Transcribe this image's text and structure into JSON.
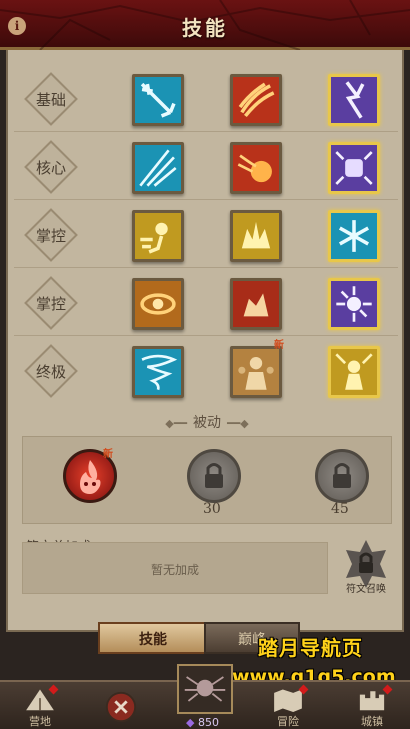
{
  "header": {
    "title": "技能",
    "info_icon": "i"
  },
  "rows": [
    {
      "label": "基础",
      "skills": [
        "trident-icon",
        "claw-fire-icon",
        "lightning-icon"
      ]
    },
    {
      "label": "核心",
      "skills": [
        "ice-shards-icon",
        "fireball-icon",
        "fist-shock-icon"
      ]
    },
    {
      "label": "掌控",
      "skills": [
        "dash-icon",
        "crown-burst-icon",
        "snowflake-icon"
      ]
    },
    {
      "label": "掌控",
      "skills": [
        "meteor-icon",
        "fire-beast-icon",
        "energy-burst-icon"
      ]
    },
    {
      "label": "终极",
      "skills": [
        "tornado-icon",
        "summon-crowd-icon",
        "golden-light-icon"
      ]
    }
  ],
  "new_badge": "新",
  "passive": {
    "title": "被动",
    "slots": [
      {
        "type": "fire",
        "new": "新"
      },
      {
        "type": "locked",
        "level": "30"
      },
      {
        "type": "locked",
        "level": "45"
      }
    ]
  },
  "rune": {
    "title": "符文总加成",
    "empty_text": "暂无加成",
    "call_label": "符文召唤"
  },
  "tabs": {
    "active": "技能",
    "inactive": "巅峰"
  },
  "nav": {
    "items": [
      "营地",
      "冒险",
      "城镇"
    ],
    "gem_count": "850"
  },
  "watermark": {
    "line1": "踏月导航页",
    "line2": "www.q1q5.com"
  },
  "colors": {
    "panel": "#c2b69f",
    "header": "#5a0f0f",
    "selected_border": "#e8c74a"
  }
}
